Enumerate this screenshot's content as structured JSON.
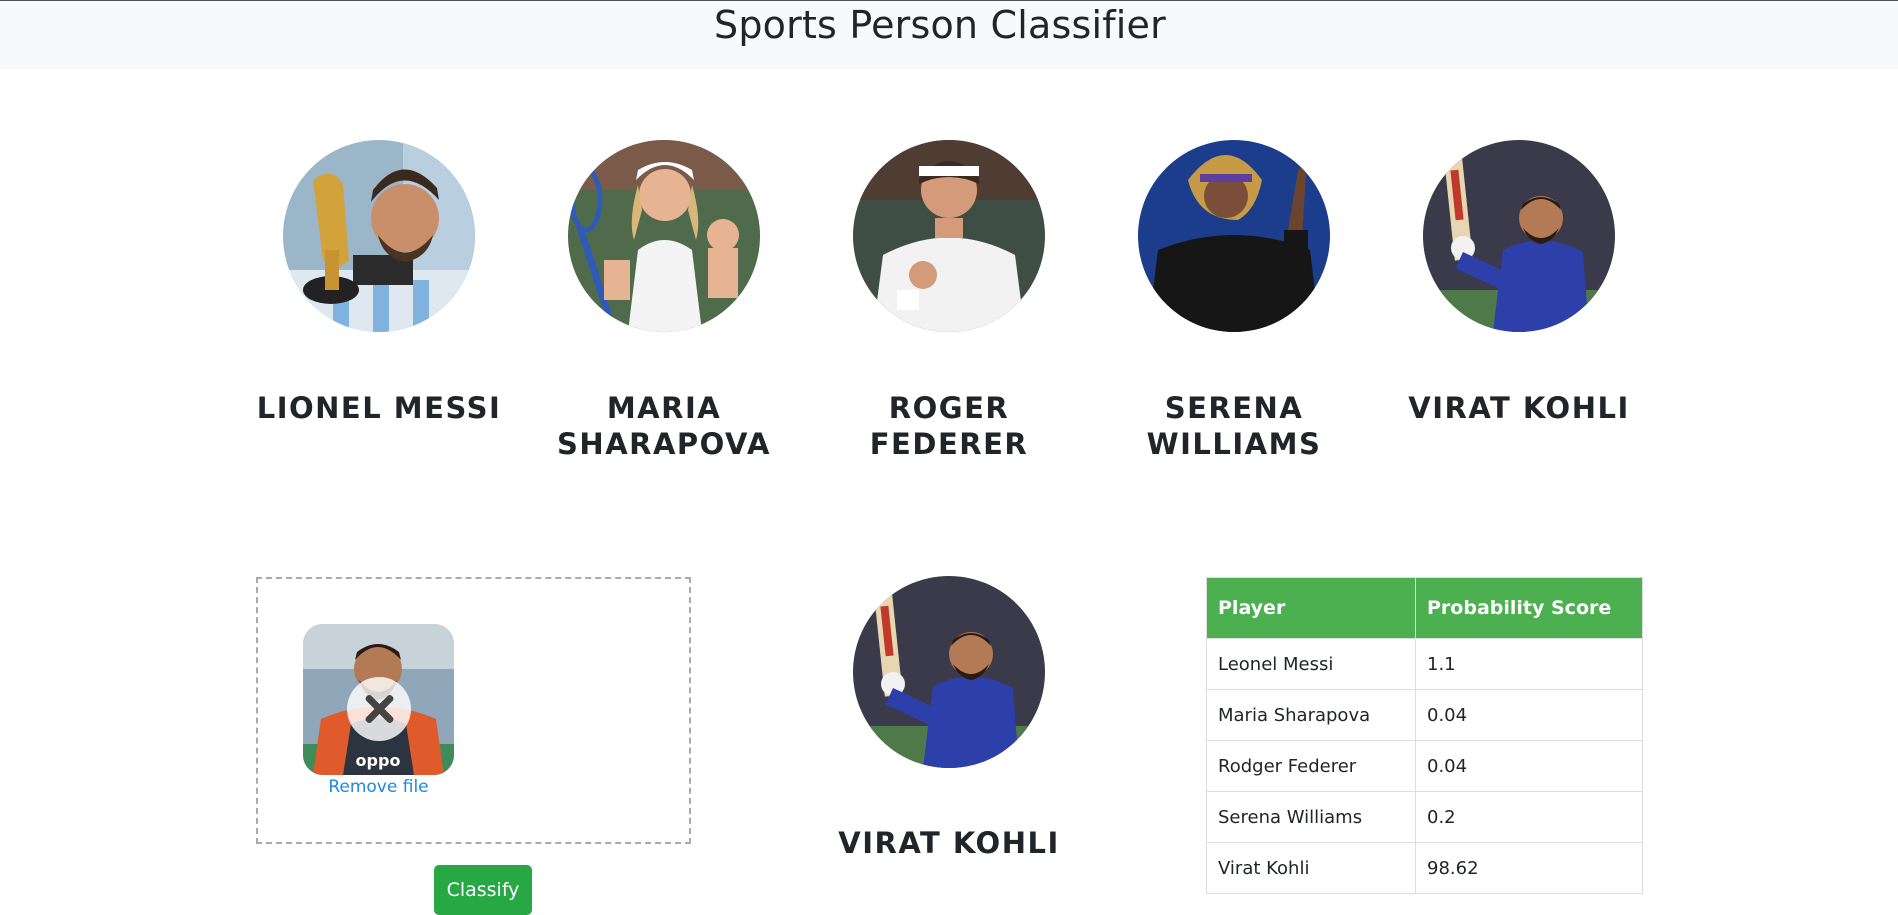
{
  "header": {
    "title": "Sports Person Classifier"
  },
  "players": [
    {
      "name": "Lionel Messi"
    },
    {
      "name": "Maria Sharapova"
    },
    {
      "name": "Roger Federer"
    },
    {
      "name": "Serena Williams"
    },
    {
      "name": "Virat Kohli"
    }
  ],
  "upload": {
    "remove_label": "Remove file"
  },
  "classify": {
    "label": "Classify"
  },
  "result": {
    "name": "Virat Kohli"
  },
  "table": {
    "headers": [
      "Player",
      "Probability Score"
    ],
    "rows": [
      [
        "Leonel Messi",
        "1.1"
      ],
      [
        "Maria Sharapova",
        "0.04"
      ],
      [
        "Rodger Federer",
        "0.04"
      ],
      [
        "Serena Williams",
        "0.2"
      ],
      [
        "Virat Kohli",
        "98.62"
      ]
    ]
  },
  "colors": {
    "table_header": "#4caf50",
    "classify_button": "#28a745",
    "link": "#1e88e5"
  }
}
